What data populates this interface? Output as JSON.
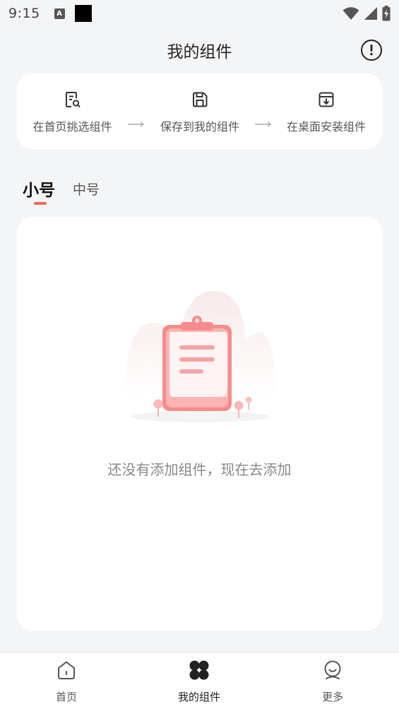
{
  "status_bar": {
    "time": "9:15",
    "a_badge": "A"
  },
  "header": {
    "title": "我的组件"
  },
  "steps": [
    {
      "label": "在首页挑选组件",
      "icon": "search-document-icon"
    },
    {
      "label": "保存到我的组件",
      "icon": "save-icon"
    },
    {
      "label": "在桌面安装组件",
      "icon": "install-download-icon"
    }
  ],
  "tabs": [
    {
      "label": "小号",
      "active": true
    },
    {
      "label": "中号",
      "active": false
    }
  ],
  "empty_state": {
    "message": "还没有添加组件，现在去添加"
  },
  "bottom_nav": [
    {
      "label": "首页",
      "icon": "home-icon",
      "active": false
    },
    {
      "label": "我的组件",
      "icon": "widgets-icon",
      "active": true
    },
    {
      "label": "更多",
      "icon": "profile-face-icon",
      "active": false
    }
  ],
  "colors": {
    "accent": "#f0695f",
    "background": "#f4f5f7",
    "card": "#ffffff"
  }
}
